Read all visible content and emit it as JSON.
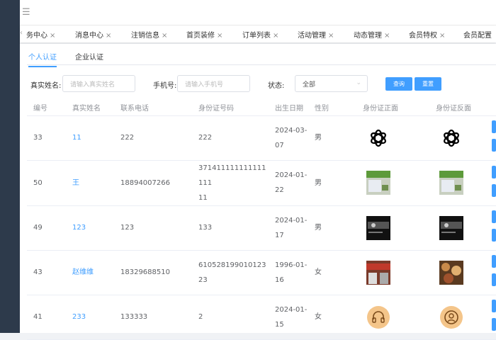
{
  "header": {
    "menu_icon": "hamburger-icon"
  },
  "tags": [
    {
      "label": "务中心"
    },
    {
      "label": "消息中心"
    },
    {
      "label": "注销信息"
    },
    {
      "label": "首页装修"
    },
    {
      "label": "订单列表"
    },
    {
      "label": "活动管理"
    },
    {
      "label": "动态管理"
    },
    {
      "label": "会员特权"
    },
    {
      "label": "会员配置"
    }
  ],
  "tabs": [
    {
      "label": "个人认证",
      "active": true
    },
    {
      "label": "企业认证",
      "active": false
    }
  ],
  "filter": {
    "name_label": "真实姓名:",
    "name_placeholder": "请输入真实姓名",
    "phone_label": "手机号:",
    "phone_placeholder": "请输入手机号",
    "status_label": "状态:",
    "status_value": "全部",
    "search": "查询",
    "reset": "重置"
  },
  "table": {
    "columns": [
      "编号",
      "真实姓名",
      "联系电话",
      "身份证号码",
      "出生日期",
      "性别",
      "身份证正面",
      "身份证反面"
    ],
    "rows": [
      {
        "id": "33",
        "name": "11",
        "phone": "222",
        "idno": "222",
        "birth1": "2024-03-",
        "birth2": "07",
        "gender": "男",
        "front": "openai-logo",
        "back": "openai-logo"
      },
      {
        "id": "50",
        "name": "王",
        "phone": "18894007266",
        "idno": "371411111111111111",
        "idno2": "11",
        "birth1": "2024-01-",
        "birth2": "22",
        "gender": "男",
        "front": "green-photo",
        "back": "green-photo"
      },
      {
        "id": "49",
        "name": "123",
        "phone": "123",
        "idno": "133",
        "birth1": "2024-01-",
        "birth2": "17",
        "gender": "男",
        "front": "dark-screenshot",
        "back": "dark-screenshot"
      },
      {
        "id": "43",
        "name": "赵维维",
        "phone": "18329688510",
        "idno": "610528199010123 23",
        "birth1": "1996-01-",
        "birth2": "16",
        "gender": "女",
        "front": "storefront-photo",
        "back": "food-photo"
      },
      {
        "id": "41",
        "name": "233",
        "phone": "133333",
        "idno": "2",
        "birth1": "2024-01-",
        "birth2": "15",
        "gender": "女",
        "front": "headset-icon",
        "back": "user-icon"
      }
    ]
  },
  "colors": {
    "accent": "#409eff",
    "sidebar": "#2d3a4b"
  }
}
